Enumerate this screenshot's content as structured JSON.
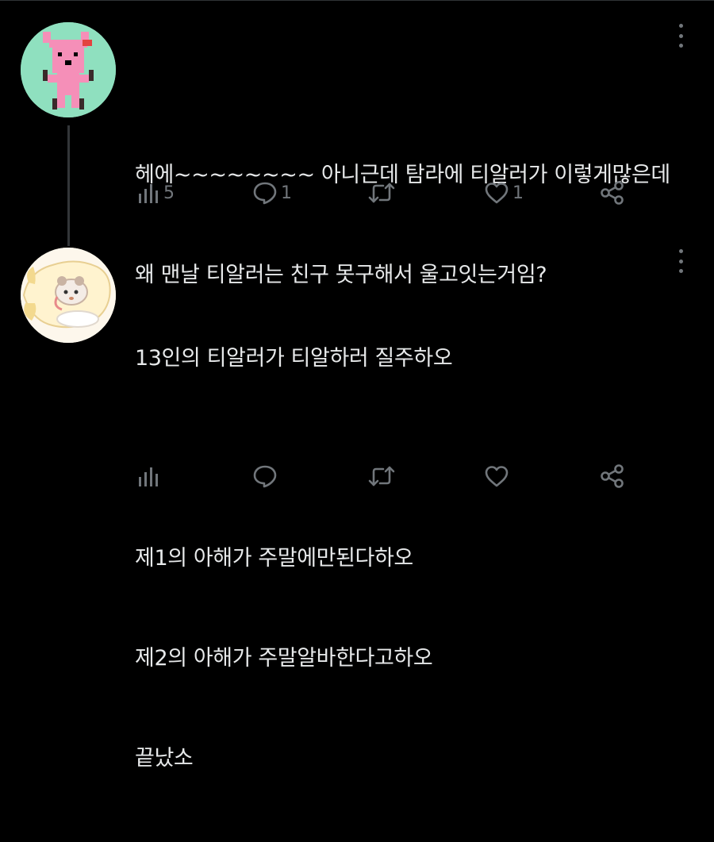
{
  "posts": [
    {
      "text_lines": [
        "헤에~~~~~~~~ 아니근데 탐라에 티알러가 이렇게많은데",
        "왜 맨날 티알러는 친구 못구해서 울고잇는거임?"
      ],
      "actions": {
        "views": "5",
        "replies": "1",
        "reposts": "",
        "likes": "1"
      }
    },
    {
      "text_lines": [
        "13인의 티알러가 티알하러 질주하오",
        "",
        "제1의 아해가 주말에만된다하오",
        "제2의 아해가 주말알바한다고하오",
        "끝났소"
      ],
      "actions": {
        "views": "",
        "replies": "",
        "reposts": "",
        "likes": ""
      }
    }
  ],
  "icons": {
    "views": "bar-chart-icon",
    "reply": "speech-bubble-icon",
    "repost": "repost-arrows-icon",
    "like": "heart-icon",
    "share": "share-icon",
    "more": "more-vertical-icon"
  },
  "colors": {
    "background": "#000000",
    "text": "#e7e9ea",
    "muted": "#71767b",
    "avatar1_bg": "#8fe0bf",
    "pixel_pink": "#f58fb8"
  }
}
